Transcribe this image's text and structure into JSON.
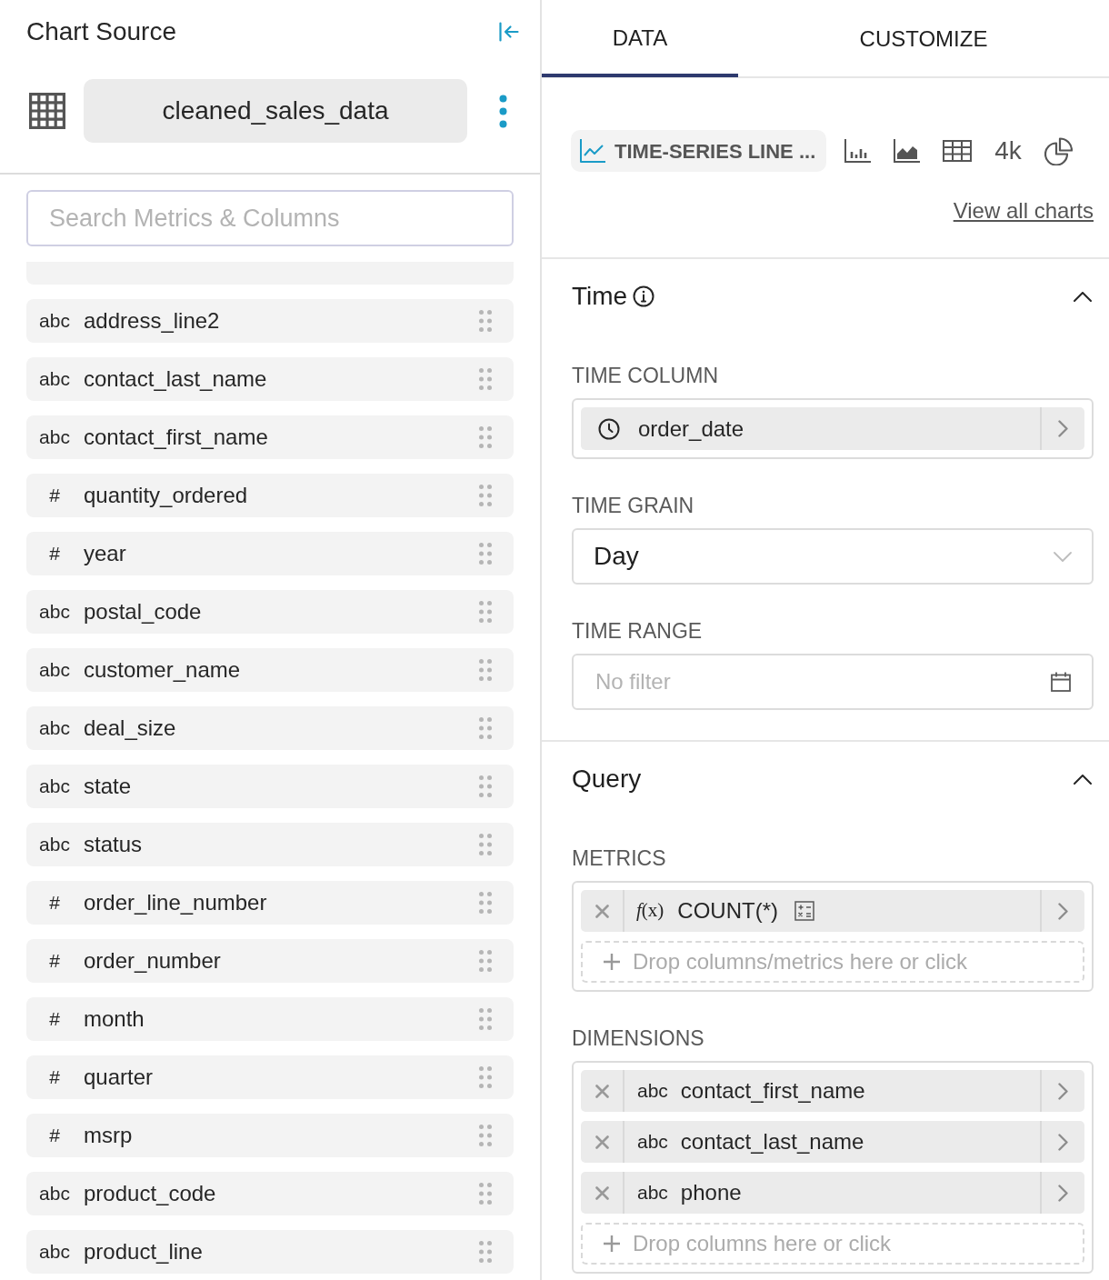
{
  "source_panel": {
    "title": "Chart Source",
    "dataset": "cleaned_sales_data",
    "search": {
      "placeholder": "Search Metrics & Columns"
    },
    "columns": [
      {
        "type_label": "abc",
        "name": "address_line2"
      },
      {
        "type_label": "abc",
        "name": "contact_last_name"
      },
      {
        "type_label": "abc",
        "name": "contact_first_name"
      },
      {
        "type_label": "#",
        "name": "quantity_ordered"
      },
      {
        "type_label": "#",
        "name": "year"
      },
      {
        "type_label": "abc",
        "name": "postal_code"
      },
      {
        "type_label": "abc",
        "name": "customer_name"
      },
      {
        "type_label": "abc",
        "name": "deal_size"
      },
      {
        "type_label": "abc",
        "name": "state"
      },
      {
        "type_label": "abc",
        "name": "status"
      },
      {
        "type_label": "#",
        "name": "order_line_number"
      },
      {
        "type_label": "#",
        "name": "order_number"
      },
      {
        "type_label": "#",
        "name": "month"
      },
      {
        "type_label": "#",
        "name": "quarter"
      },
      {
        "type_label": "#",
        "name": "msrp"
      },
      {
        "type_label": "abc",
        "name": "product_code"
      },
      {
        "type_label": "abc",
        "name": "product_line"
      }
    ]
  },
  "editor_panel": {
    "tabs": [
      {
        "label": "DATA",
        "selected": true
      },
      {
        "label": "CUSTOMIZE",
        "selected": false
      }
    ],
    "chart_picker": {
      "current": "TIME-SERIES LINE ...",
      "big_number_label": "4k",
      "view_all": "View all charts"
    },
    "sections": [
      {
        "title": "Time",
        "info": true,
        "expanded": true,
        "controls": [
          {
            "kind": "column_select",
            "label": "TIME COLUMN",
            "value": "order_date"
          },
          {
            "kind": "select",
            "label": "TIME GRAIN",
            "value": "Day"
          },
          {
            "kind": "date_range",
            "label": "TIME RANGE",
            "placeholder": "No filter"
          }
        ]
      },
      {
        "title": "Query",
        "expanded": true,
        "controls": [
          {
            "kind": "drop_zone",
            "label": "METRICS",
            "items": [
              {
                "kind": "metric",
                "prefix": "*f*(x)",
                "name": "COUNT(*)"
              }
            ],
            "placeholder": "Drop columns/metrics here or click"
          },
          {
            "kind": "drop_zone",
            "label": "DIMENSIONS",
            "items": [
              {
                "kind": "column",
                "type_label": "abc",
                "name": "contact_first_name"
              },
              {
                "kind": "column",
                "type_label": "abc",
                "name": "contact_last_name"
              },
              {
                "kind": "column",
                "type_label": "abc",
                "name": "phone"
              }
            ],
            "placeholder": "Drop columns here or click"
          }
        ]
      }
    ]
  }
}
